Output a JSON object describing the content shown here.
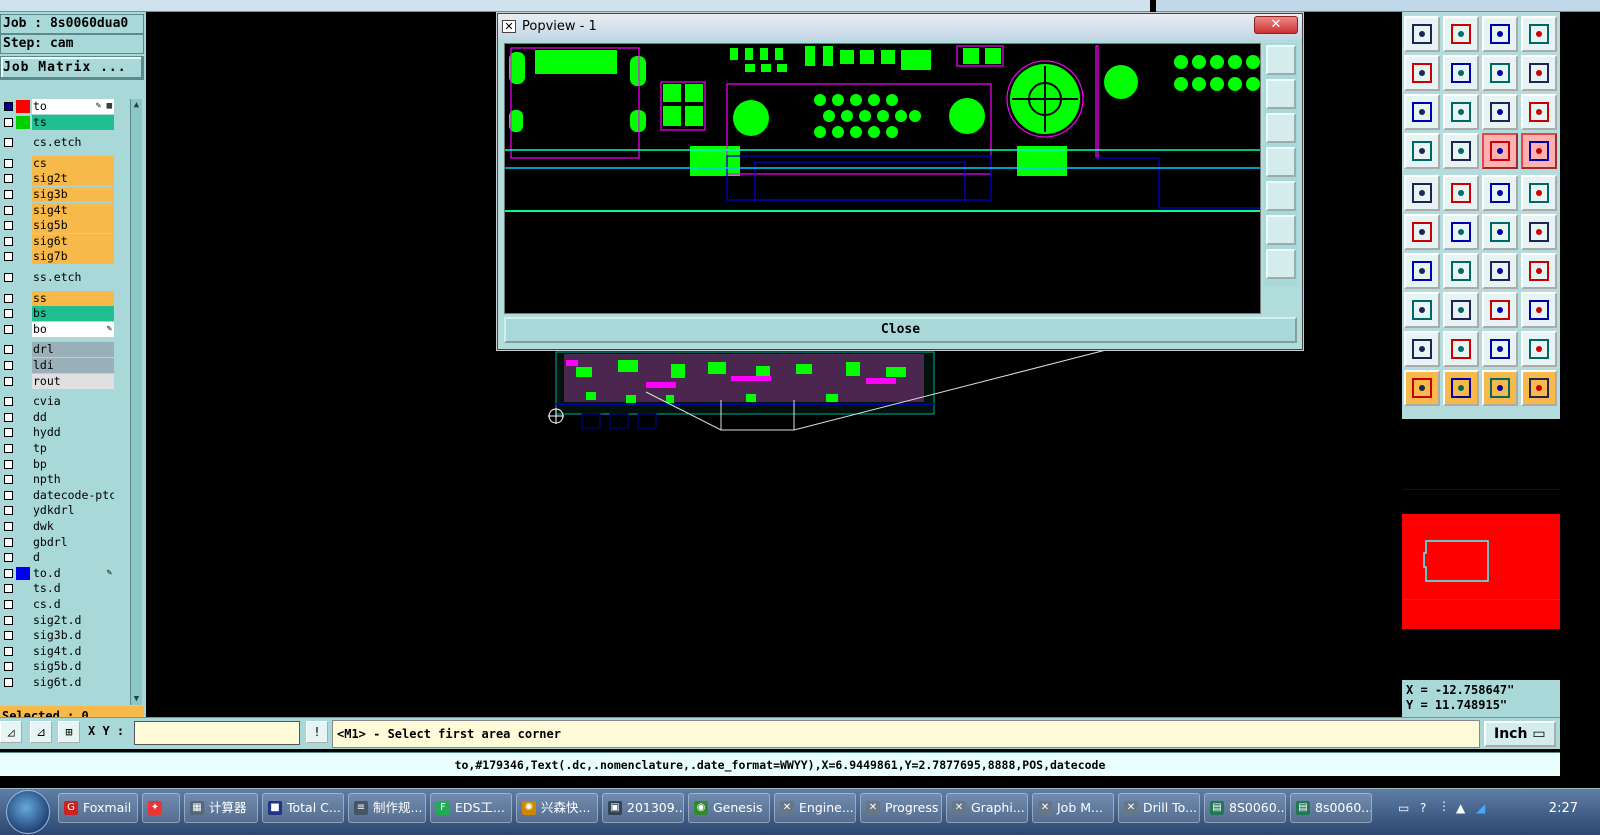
{
  "job": {
    "label": "Job : 8s0060dua0",
    "step": "Step: cam",
    "matrix_button": "Job Matrix ..."
  },
  "layers": [
    {
      "name": "to",
      "color": "#ffffff",
      "swatch": "#ff0000",
      "tag": "✎ ▦",
      "checked": true
    },
    {
      "name": "ts",
      "color": "#1fbf8f",
      "swatch": "#00d000",
      "tag": "",
      "checked": false
    },
    {
      "name": "cs.etch",
      "color": "#a8d8d8",
      "swatch": "",
      "tag": "",
      "checked": false
    },
    {
      "name": "cs",
      "color": "#f6b94a",
      "swatch": "",
      "tag": "",
      "checked": false
    },
    {
      "name": "sig2t",
      "color": "#f6b94a",
      "swatch": "",
      "tag": "",
      "checked": false
    },
    {
      "name": "sig3b",
      "color": "#f6b94a",
      "swatch": "",
      "tag": "",
      "checked": false
    },
    {
      "name": "sig4t",
      "color": "#f6b94a",
      "swatch": "",
      "tag": "",
      "checked": false
    },
    {
      "name": "sig5b",
      "color": "#f6b94a",
      "swatch": "",
      "tag": "",
      "checked": false
    },
    {
      "name": "sig6t",
      "color": "#f6b94a",
      "swatch": "",
      "tag": "",
      "checked": false
    },
    {
      "name": "sig7b",
      "color": "#f6b94a",
      "swatch": "",
      "tag": "",
      "checked": false
    },
    {
      "name": "ss.etch",
      "color": "#a8d8d8",
      "swatch": "",
      "tag": "",
      "checked": false
    },
    {
      "name": "ss",
      "color": "#f6b94a",
      "swatch": "",
      "tag": "",
      "checked": false
    },
    {
      "name": "bs",
      "color": "#1fbf8f",
      "swatch": "",
      "tag": "",
      "checked": false
    },
    {
      "name": "bo",
      "color": "#ffffff",
      "swatch": "",
      "tag": "✎",
      "checked": false
    },
    {
      "name": "drl",
      "color": "#9ab0b8",
      "swatch": "",
      "tag": "",
      "checked": false
    },
    {
      "name": "ldi",
      "color": "#9ab0b8",
      "swatch": "",
      "tag": "",
      "checked": false
    },
    {
      "name": "rout",
      "color": "#e0e0e0",
      "swatch": "",
      "tag": "",
      "checked": false
    },
    {
      "name": "cvia",
      "color": "#a8d8d8",
      "swatch": "",
      "tag": "",
      "checked": false
    },
    {
      "name": "dd",
      "color": "#a8d8d8",
      "swatch": "",
      "tag": "",
      "checked": false
    },
    {
      "name": "hydd",
      "color": "#a8d8d8",
      "swatch": "",
      "tag": "",
      "checked": false
    },
    {
      "name": "tp",
      "color": "#a8d8d8",
      "swatch": "",
      "tag": "",
      "checked": false
    },
    {
      "name": "bp",
      "color": "#a8d8d8",
      "swatch": "",
      "tag": "",
      "checked": false
    },
    {
      "name": "npth",
      "color": "#a8d8d8",
      "swatch": "",
      "tag": "",
      "checked": false
    },
    {
      "name": "datecode-ptc",
      "color": "#a8d8d8",
      "swatch": "",
      "tag": "",
      "checked": false
    },
    {
      "name": "ydkdrl",
      "color": "#a8d8d8",
      "swatch": "",
      "tag": "",
      "checked": false
    },
    {
      "name": "dwk",
      "color": "#a8d8d8",
      "swatch": "",
      "tag": "",
      "checked": false
    },
    {
      "name": "gbdrl",
      "color": "#a8d8d8",
      "swatch": "",
      "tag": "",
      "checked": false
    },
    {
      "name": "d",
      "color": "#a8d8d8",
      "swatch": "",
      "tag": "",
      "checked": false
    },
    {
      "name": "to.d",
      "color": "#a8d8d8",
      "swatch": "#0000ee",
      "tag": "✎",
      "checked": false
    },
    {
      "name": "ts.d",
      "color": "#a8d8d8",
      "swatch": "",
      "tag": "",
      "checked": false
    },
    {
      "name": "cs.d",
      "color": "#a8d8d8",
      "swatch": "",
      "tag": "",
      "checked": false
    },
    {
      "name": "sig2t.d",
      "color": "#a8d8d8",
      "swatch": "",
      "tag": "",
      "checked": false
    },
    {
      "name": "sig3b.d",
      "color": "#a8d8d8",
      "swatch": "",
      "tag": "",
      "checked": false
    },
    {
      "name": "sig4t.d",
      "color": "#a8d8d8",
      "swatch": "",
      "tag": "",
      "checked": false
    },
    {
      "name": "sig5b.d",
      "color": "#a8d8d8",
      "swatch": "",
      "tag": "",
      "checked": false
    },
    {
      "name": "sig6t.d",
      "color": "#a8d8d8",
      "swatch": "",
      "tag": "",
      "checked": false
    }
  ],
  "selected": "Selected : 0",
  "popup": {
    "title": "Popview - 1",
    "close_x": "✕",
    "close_button": "Close"
  },
  "coords": {
    "x": "X = -12.758647\"",
    "y": "Y = 11.748915\""
  },
  "cmd": {
    "xy_label": "X Y :",
    "xy_value": "",
    "prompt": "<M1> - Select first area corner",
    "unit": "Inch ▭"
  },
  "status": "to,#179346,Text(.dc,.nomenclature,.date_format=WWYY),X=6.9449861,Y=2.7877695,8888,POS,datecode",
  "right_tools": [
    "open-job-icon",
    "save-icon",
    "home-icon",
    "window-icon",
    "prev-view-icon",
    "next-view-icon",
    "undo-view-icon",
    "s-curve-icon",
    "zoom-fit-icon",
    "zoom-home-icon",
    "scale-1-2-icon",
    "help-icon",
    "settings-icon",
    "grid-icon",
    "snap-a-icon",
    "snap-b-icon",
    "pad-icon",
    "flash-icon",
    "ruler-icon",
    "dot-icon",
    "connect-icon",
    "cross-icon",
    "line-point-icon",
    "line-point2-icon",
    "angle-icon",
    "slash-icon",
    "arc-icon",
    "compare-icon",
    "move-icon",
    "minus-icon",
    "box-icon",
    "copy-icon",
    "triangle-a-icon",
    "triangle-b-icon",
    "triangle-c-icon",
    "triangle-d-icon",
    "pointer-icon",
    "select-icon",
    "pick-icon",
    "route-icon"
  ],
  "taskbar": [
    {
      "label": "Foxmail",
      "color": "#c22",
      "glyph": "G"
    },
    {
      "label": "",
      "color": "#e33",
      "glyph": "✦"
    },
    {
      "label": "计算器",
      "color": "#567",
      "glyph": "▦"
    },
    {
      "label": "Total C...",
      "color": "#238",
      "glyph": "■"
    },
    {
      "label": "制作规...",
      "color": "#456",
      "glyph": "≡"
    },
    {
      "label": "EDS工...",
      "color": "#2a5",
      "glyph": "F"
    },
    {
      "label": "兴森快...",
      "color": "#c80",
      "glyph": "✺"
    },
    {
      "label": "201309...",
      "color": "#345",
      "glyph": "▣"
    },
    {
      "label": "Genesis",
      "color": "#383",
      "glyph": "◉"
    },
    {
      "label": "Engine...",
      "color": "#678",
      "glyph": "✕"
    },
    {
      "label": "Progress",
      "color": "#678",
      "glyph": "✕"
    },
    {
      "label": "Graphi...",
      "color": "#678",
      "glyph": "✕"
    },
    {
      "label": "Job M...",
      "color": "#678",
      "glyph": "✕"
    },
    {
      "label": "Drill To...",
      "color": "#678",
      "glyph": "✕"
    },
    {
      "label": "8S0060...",
      "color": "#275",
      "glyph": "▤"
    },
    {
      "label": "8s0060...",
      "color": "#275",
      "glyph": "▤"
    }
  ],
  "tray": {
    "time": "2:27"
  }
}
